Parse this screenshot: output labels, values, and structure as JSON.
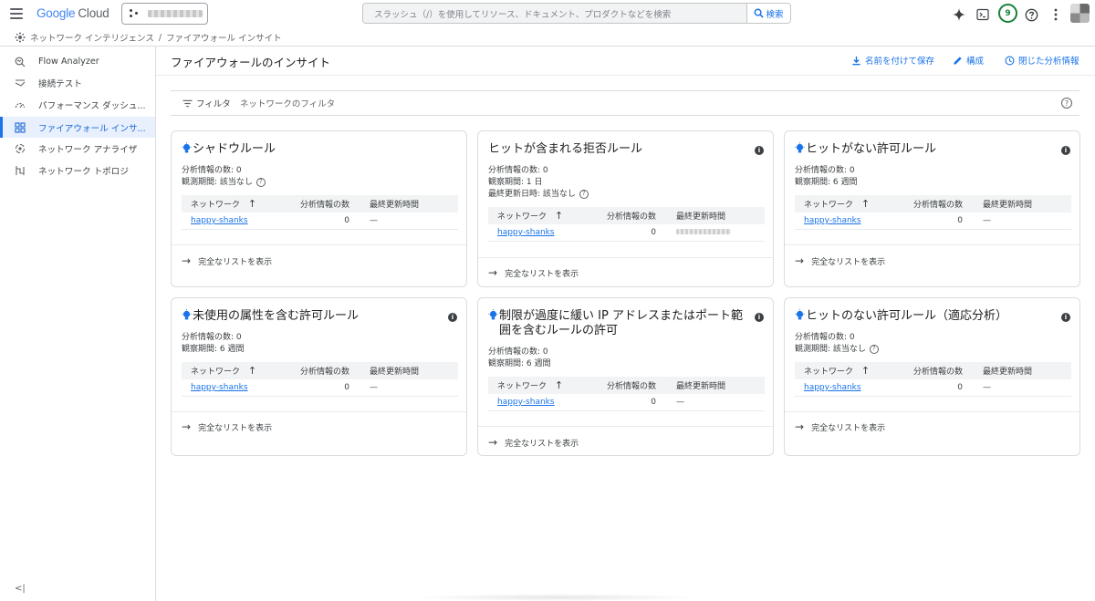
{
  "app": {
    "logo_google": "Google",
    "logo_cloud": "Cloud"
  },
  "search": {
    "placeholder": "スラッシュ（/）を使用してリソース、ドキュメント、プロダクトなどを検索",
    "button": "検索"
  },
  "topbar": {
    "notifications_count": "9"
  },
  "breadcrumb": {
    "part1": "ネットワーク インテリジェンス",
    "sep": "/",
    "part2": "ファイアウォール インサイト"
  },
  "sidebar": {
    "items": [
      {
        "label": "Flow Analyzer",
        "icon": "flow-analyzer-icon"
      },
      {
        "label": "接続テスト",
        "icon": "connectivity-test-icon"
      },
      {
        "label": "パフォーマンス ダッシュ...",
        "icon": "performance-dashboard-icon"
      },
      {
        "label": "ファイアウォール インサ...",
        "icon": "firewall-insights-icon",
        "active": true
      },
      {
        "label": "ネットワーク アナライザ",
        "icon": "network-analyzer-icon"
      },
      {
        "label": "ネットワーク トポロジ",
        "icon": "network-topology-icon"
      }
    ],
    "collapse": "<|"
  },
  "main": {
    "title": "ファイアウォールのインサイト",
    "actions": {
      "save": "名前を付けて保存",
      "configure": "構成",
      "closed_insights": "閉じた分析情報"
    },
    "filter": {
      "label": "フィルタ",
      "placeholder": "ネットワークのフィルタ"
    }
  },
  "table_headers": {
    "network": "ネットワーク",
    "count": "分析情報の数",
    "updated": "最終更新時間"
  },
  "full_list_label": "完全なリストを表示",
  "cards": [
    {
      "title": "シャドウルール",
      "line1": "分析情報の数: 0",
      "line2": "観測期間: 該当なし",
      "row": {
        "network": "happy-shanks",
        "count": "0",
        "updated": "—"
      }
    },
    {
      "title": "ヒットが含まれる拒否ルール",
      "line1": "分析情報の数: 0",
      "line2": "観察期間: 1 日",
      "line3": "最終更新日時: 該当なし",
      "row": {
        "network": "happy-shanks",
        "count": "0",
        "updated": ""
      }
    },
    {
      "title": "ヒットがない許可ルール",
      "line1": "分析情報の数: 0",
      "line2": "観察期間: 6 週間",
      "row": {
        "network": "happy-shanks",
        "count": "0",
        "updated": "—"
      }
    },
    {
      "title": "未使用の属性を含む許可ルール",
      "line1": "分析情報の数: 0",
      "line2": "観察期間: 6 週間",
      "row": {
        "network": "happy-shanks",
        "count": "0",
        "updated": "—"
      }
    },
    {
      "title": "制限が過度に緩い IP アドレスまたはポート範囲を含むルールの許可",
      "line1": "分析情報の数: 0",
      "line2": "観察期間: 6 週間",
      "row": {
        "network": "happy-shanks",
        "count": "0",
        "updated": "—"
      }
    },
    {
      "title": "ヒットのない許可ルール（適応分析）",
      "line1": "分析情報の数: 0",
      "line2": "観測期間: 該当なし",
      "row": {
        "network": "happy-shanks",
        "count": "0",
        "updated": "—"
      }
    }
  ]
}
